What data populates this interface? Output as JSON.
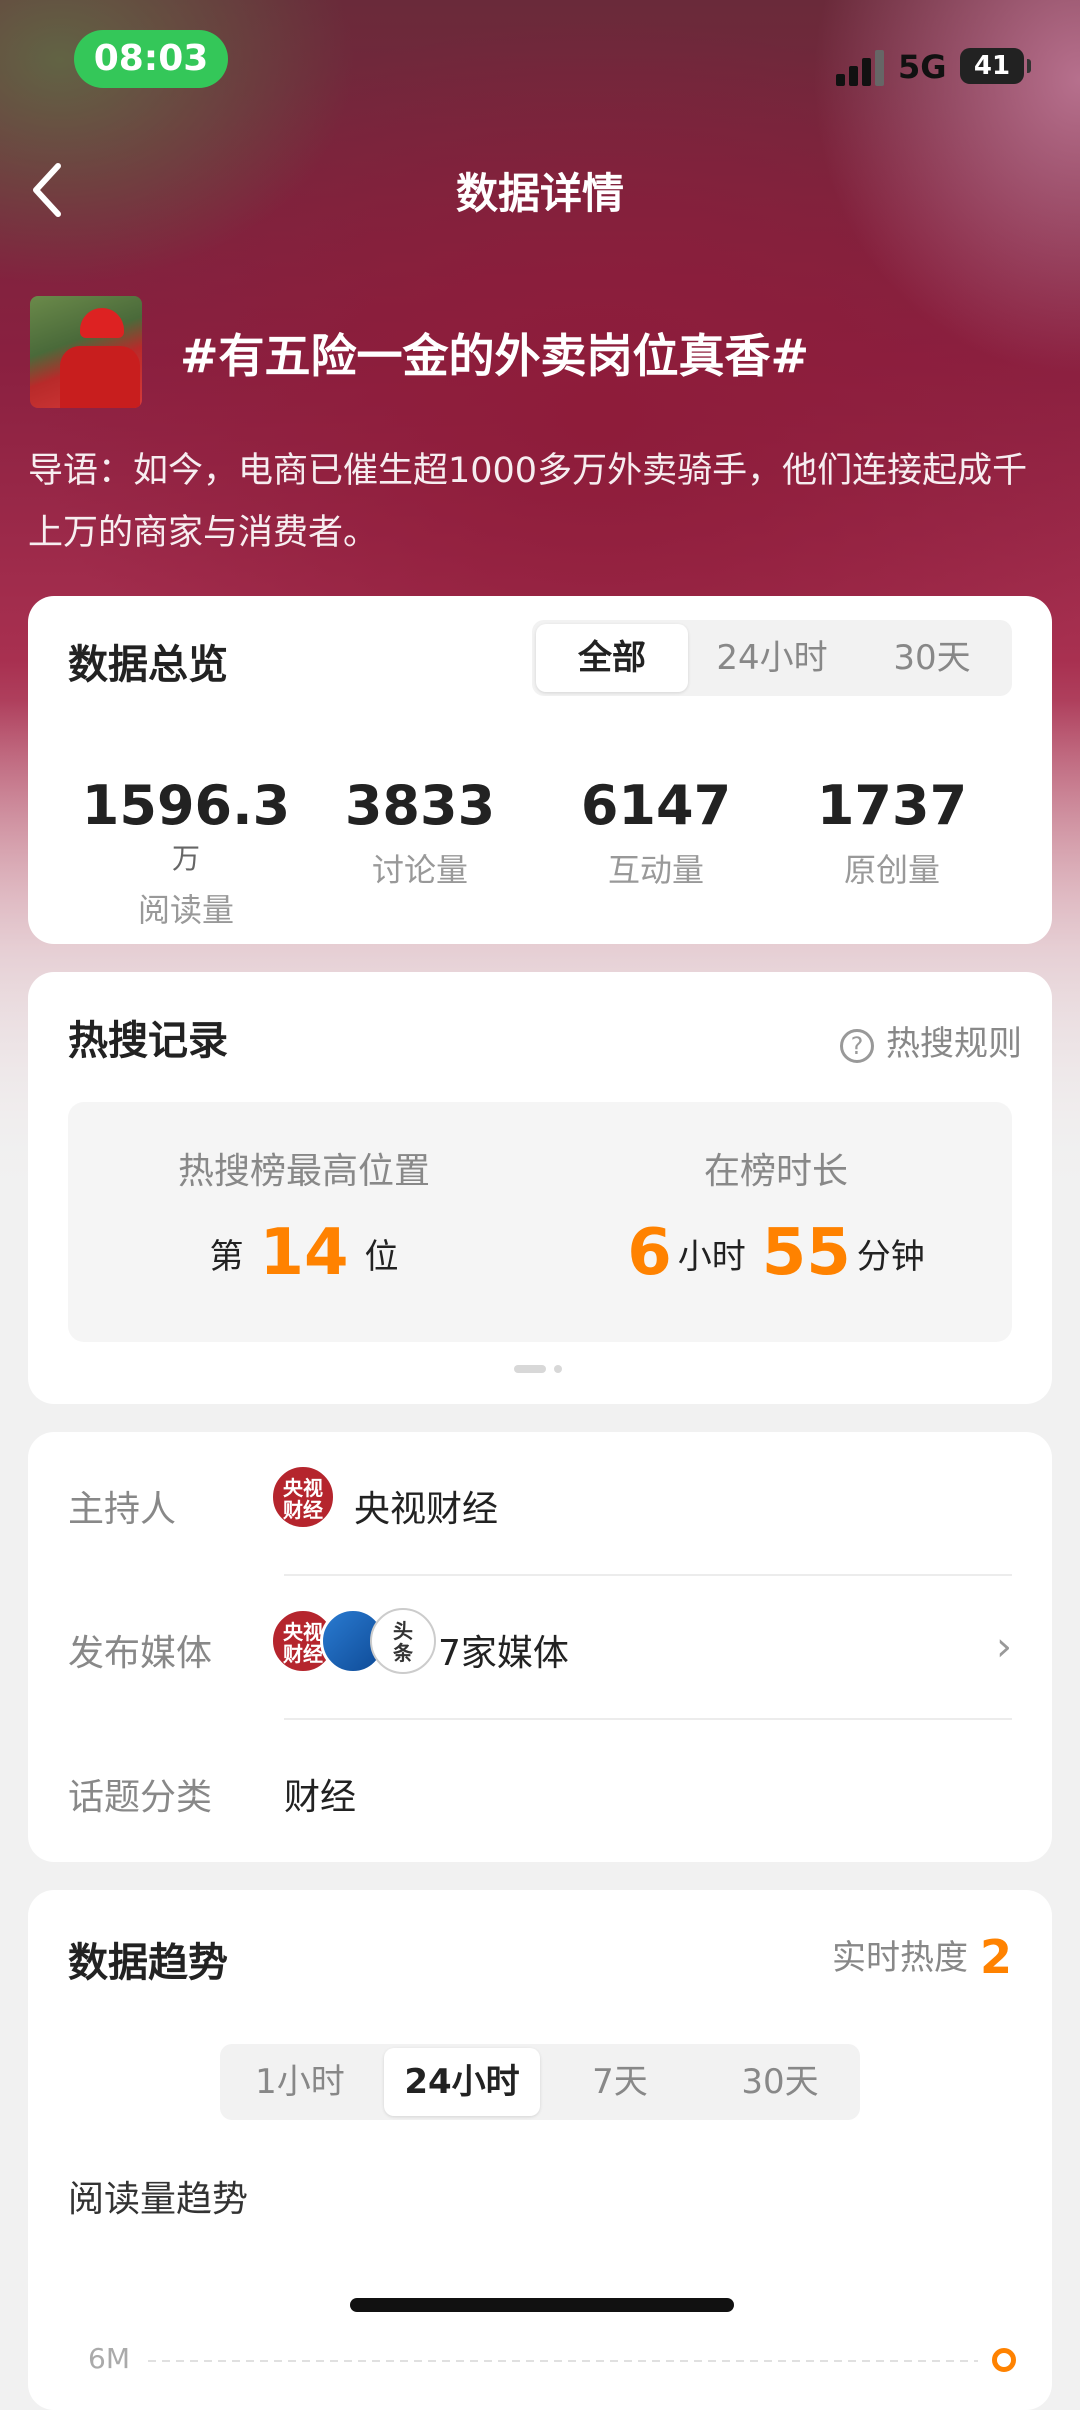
{
  "status": {
    "time": "08:03",
    "network": "5G",
    "battery": "41"
  },
  "nav": {
    "title": "数据详情"
  },
  "topic": {
    "title": "#有五险一金的外卖岗位真香#",
    "intro": "导语：如今，电商已催生超1000多万外卖骑手，他们连接起成千上万的商家与消费者。"
  },
  "overview": {
    "title": "数据总览",
    "tabs": [
      "全部",
      "24小时",
      "30天"
    ],
    "active_tab": "全部",
    "stats": [
      {
        "value": "1596.3",
        "unit": "万",
        "label": "阅读量"
      },
      {
        "value": "3833",
        "unit": "",
        "label": "讨论量"
      },
      {
        "value": "6147",
        "unit": "",
        "label": "互动量"
      },
      {
        "value": "1737",
        "unit": "",
        "label": "原创量"
      }
    ]
  },
  "hot_search": {
    "title": "热搜记录",
    "rules_label": "热搜规则",
    "peak": {
      "label": "热搜榜最高位置",
      "prefix": "第",
      "value": "14",
      "suffix": "位"
    },
    "duration": {
      "label": "在榜时长",
      "hours": "6",
      "hours_unit": "小时",
      "minutes": "55",
      "minutes_unit": "分钟"
    }
  },
  "info": {
    "host_label": "主持人",
    "host_name": "央视财经",
    "media_label": "发布媒体",
    "media_count": "7家媒体",
    "category_label": "话题分类",
    "category": "财经",
    "logo_cctv_text": "央视财经",
    "logo_white_text": "头条"
  },
  "trend": {
    "title": "数据趋势",
    "heat_label": "实时热度",
    "heat_value": "2",
    "tabs": [
      "1小时",
      "24小时",
      "7天",
      "30天"
    ],
    "active_tab": "24小时",
    "chart_title": "阅读量趋势",
    "y_tick": "6M"
  },
  "colors": {
    "accent": "#ff8200",
    "status_green": "#34c759",
    "cctv_red": "#b5252d"
  }
}
